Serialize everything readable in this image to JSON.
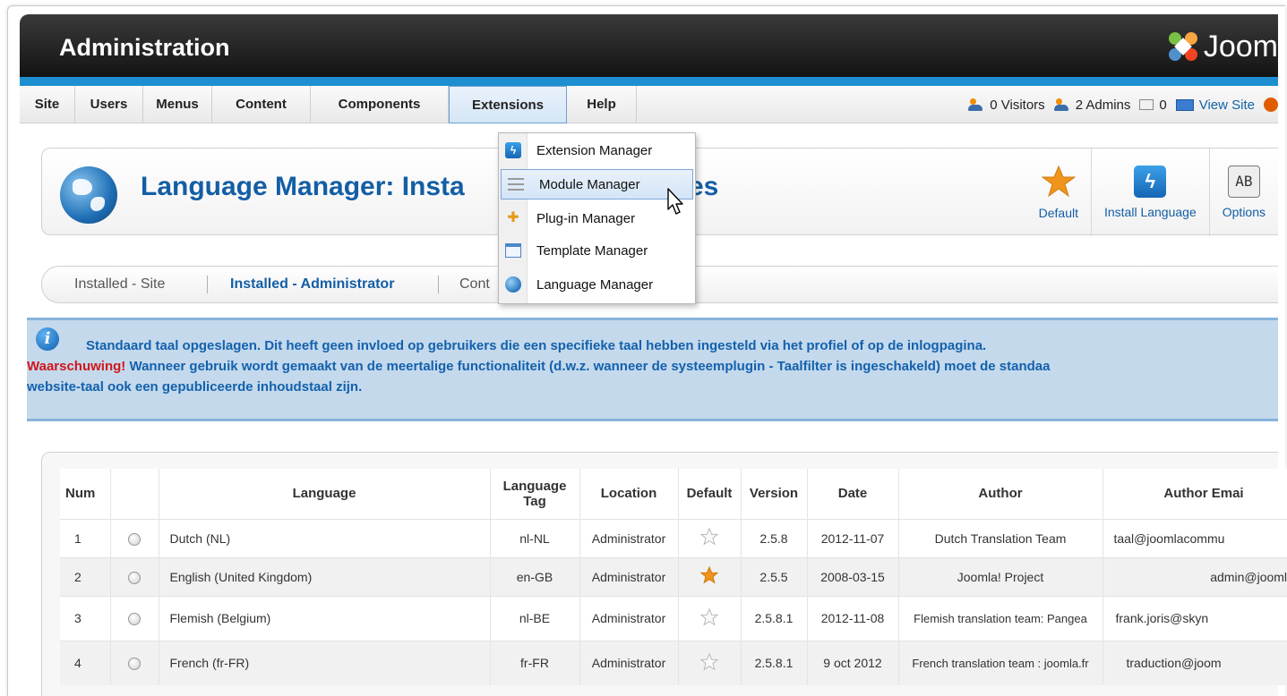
{
  "header": {
    "title": "Administration",
    "logo_text": "Joom"
  },
  "menu": {
    "items": [
      "Site",
      "Users",
      "Menus",
      "Content",
      "Components",
      "Extensions",
      "Help"
    ],
    "active": "Extensions"
  },
  "status": {
    "visitors": "0 Visitors",
    "admins": "2 Admins",
    "messages": "0",
    "view_site": "View Site"
  },
  "dropdown": {
    "items": [
      {
        "label": "Extension Manager",
        "icon": "extension-icon"
      },
      {
        "label": "Module Manager",
        "icon": "module-icon",
        "highlighted": true
      },
      {
        "label": "Plug-in Manager",
        "icon": "plugin-icon"
      },
      {
        "label": "Template Manager",
        "icon": "template-icon"
      },
      {
        "label": "Language Manager",
        "icon": "language-icon"
      }
    ]
  },
  "page": {
    "title_visible": "Language Manager: Insta",
    "title_tail": "es"
  },
  "toolbar": {
    "default_label": "Default",
    "install_label": "Install Language",
    "options_label": "Options",
    "options_glyph": "AB"
  },
  "subtabs": {
    "site": "Installed - Site",
    "administrator": "Installed - Administrator",
    "content": "Cont"
  },
  "message": {
    "line1": "Standaard taal opgeslagen. Dit heeft geen invloed op gebruikers die een specifieke taal hebben ingesteld via het profiel of op de inlogpagina.",
    "warning_label": "Waarschuwing!",
    "line2": " Wanneer gebruik wordt gemaakt van de meertalige functionaliteit (d.w.z. wanneer de systeemplugin - Taalfilter is ingeschakeld) moet de standaa",
    "line3": "website-taal ook een gepubliceerde inhoudstaal zijn."
  },
  "table": {
    "headers": {
      "num": "Num",
      "language": "Language",
      "tag": "Language Tag",
      "location": "Location",
      "default": "Default",
      "version": "Version",
      "date": "Date",
      "author": "Author",
      "email": "Author Emai"
    },
    "rows": [
      {
        "num": "1",
        "language": "Dutch (NL)",
        "tag": "nl-NL",
        "location": "Administrator",
        "default": false,
        "version": "2.5.8",
        "date": "2012-11-07",
        "author": "Dutch Translation Team",
        "email": "taal@joomlacommu"
      },
      {
        "num": "2",
        "language": "English (United Kingdom)",
        "tag": "en-GB",
        "location": "Administrator",
        "default": true,
        "version": "2.5.5",
        "date": "2008-03-15",
        "author": "Joomla! Project",
        "email": "admin@joomla.o"
      },
      {
        "num": "3",
        "language": "Flemish (Belgium)",
        "tag": "nl-BE",
        "location": "Administrator",
        "default": false,
        "version": "2.5.8.1",
        "date": "2012-11-08",
        "author": "Flemish translation team: Pangea",
        "email": "frank.joris@skyn"
      },
      {
        "num": "4",
        "language": "French (fr-FR)",
        "tag": "fr-FR",
        "location": "Administrator",
        "default": false,
        "version": "2.5.8.1",
        "date": "9 oct 2012",
        "author": "French translation team : joomla.fr",
        "email": "traduction@joom"
      }
    ]
  },
  "colors": {
    "accent": "#135ea5",
    "header_bar": "#1d8fd1",
    "warning": "#d0161b",
    "star_default": "#f0941c"
  }
}
